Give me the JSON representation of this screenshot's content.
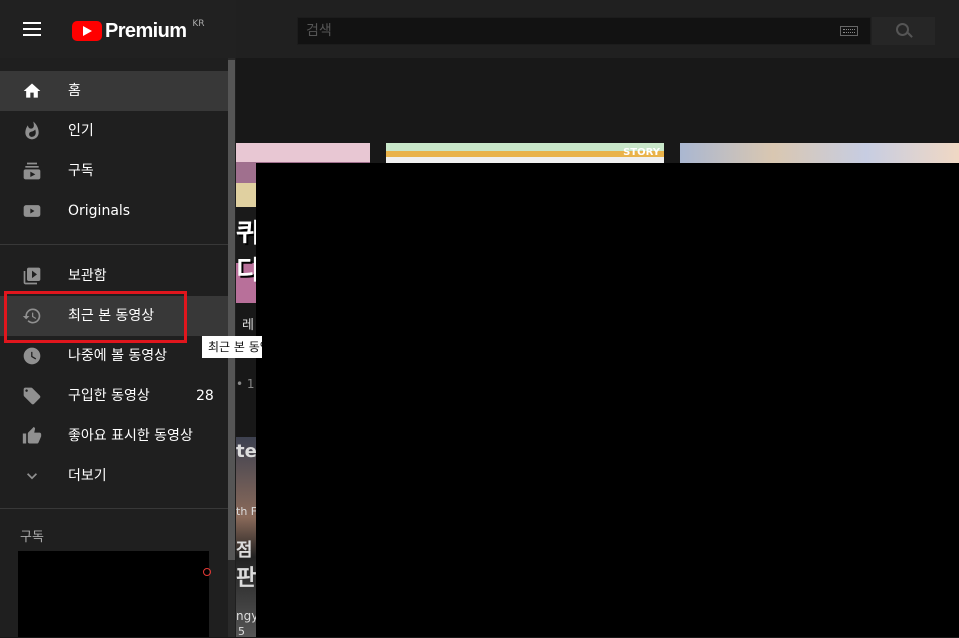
{
  "header": {
    "logo_text": "Premium",
    "logo_region": "KR",
    "search_placeholder": "검색"
  },
  "sidebar": {
    "primary": [
      {
        "label": "홈",
        "icon": "home-icon",
        "active": true
      },
      {
        "label": "인기",
        "icon": "fire-icon"
      },
      {
        "label": "구독",
        "icon": "subscriptions-icon"
      },
      {
        "label": "Originals",
        "icon": "youtube-play-icon"
      }
    ],
    "library": [
      {
        "label": "보관함",
        "icon": "library-icon"
      },
      {
        "label": "최근 본 동영상",
        "icon": "history-icon",
        "hovered": true
      },
      {
        "label": "나중에 볼 동영상",
        "icon": "clock-icon"
      },
      {
        "label": "구입한 동영상",
        "icon": "tag-icon",
        "count": "28"
      },
      {
        "label": "좋아요 표시한 동영상",
        "icon": "thumbs-up-icon"
      },
      {
        "label": "더보기",
        "icon": "chevron-down-icon"
      }
    ],
    "subscriptions_title": "구독"
  },
  "tooltip": {
    "text": "최근 본 동영상"
  },
  "content": {
    "fragments": {
      "f1": "레",
      "f2": "• 1",
      "f3": "te",
      "f4": "th F",
      "f5": "점",
      "f6": "판",
      "f7": "ngy",
      "f8": "5",
      "story": "STORY",
      "thumb_text": "퀴\n디"
    }
  },
  "colors": {
    "highlight_border": "#e0161d",
    "brand_red": "#ff0000"
  }
}
